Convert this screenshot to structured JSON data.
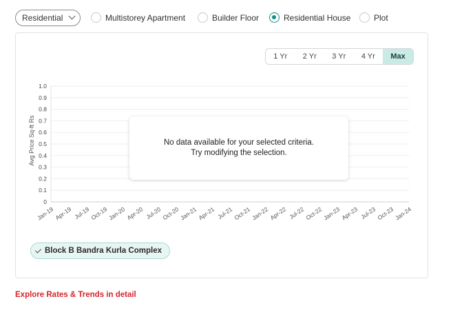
{
  "filters": {
    "property_type_select": "Residential",
    "options": [
      {
        "label": "Multistorey Apartment",
        "selected": false
      },
      {
        "label": "Builder Floor",
        "selected": false
      },
      {
        "label": "Residential House",
        "selected": true
      },
      {
        "label": "Plot",
        "selected": false
      }
    ]
  },
  "range_tabs": [
    {
      "label": "1 Yr",
      "active": false
    },
    {
      "label": "2 Yr",
      "active": false
    },
    {
      "label": "3 Yr",
      "active": false
    },
    {
      "label": "4 Yr",
      "active": false
    },
    {
      "label": "Max",
      "active": true
    }
  ],
  "chart_data": {
    "type": "line",
    "title": "",
    "xlabel": "",
    "ylabel": "Avg Price Sq-ft Rs",
    "ylim": [
      0,
      1.0
    ],
    "y_ticks": [
      "1.0",
      "0.9",
      "0.8",
      "0.7",
      "0.6",
      "0.5",
      "0.4",
      "0.3",
      "0.2",
      "0.1",
      "0"
    ],
    "x_ticks": [
      "Jan-19",
      "Apr-19",
      "Jul-19",
      "Oct-19",
      "Jan-20",
      "Apr-20",
      "Jul-20",
      "Oct-20",
      "Jan-21",
      "Apr-21",
      "Jul-21",
      "Oct-21",
      "Jan-22",
      "Apr-22",
      "Jul-22",
      "Oct-22",
      "Jan-23",
      "Apr-23",
      "Jul-23",
      "Oct-23",
      "Jan-24"
    ],
    "series": [],
    "grid": true
  },
  "no_data": {
    "line1": "No data available for your selected criteria.",
    "line2": "Try modifying the selection."
  },
  "locality_chip": "Block B Bandra Kurla Complex",
  "explore_link": "Explore Rates & Trends in detail",
  "colors": {
    "accent": "#138f87",
    "active_tab_bg": "#c9ebe6",
    "chip_bg": "#e8f6f3",
    "link": "#d8232a"
  }
}
